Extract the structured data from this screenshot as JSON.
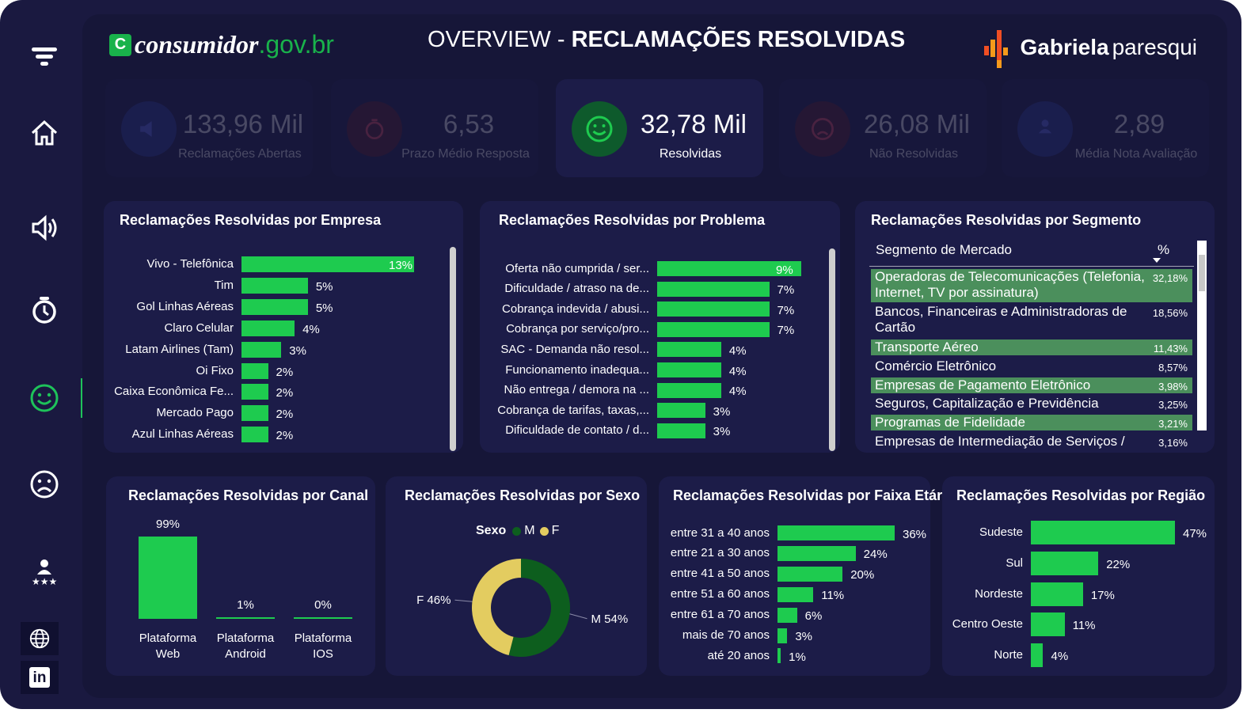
{
  "header": {
    "logo_left_badge": "C",
    "logo_left_1": "consumidor",
    "logo_left_2": ".gov.br",
    "title_light": "OVERVIEW - ",
    "title_bold": "RECLAMAÇÕES RESOLVIDAS",
    "logo_right_name": "Gabriela",
    "logo_right_surname": "paresqui"
  },
  "sidebar": {
    "items": [
      {
        "icon": "filter-icon"
      },
      {
        "icon": "home-icon"
      },
      {
        "icon": "speaker-icon"
      },
      {
        "icon": "timer-icon"
      },
      {
        "icon": "smile-icon",
        "active": true
      },
      {
        "icon": "sad-face-icon"
      },
      {
        "icon": "rating-person-icon"
      }
    ],
    "social": [
      {
        "icon": "globe-icon"
      },
      {
        "icon": "linkedin-icon",
        "label": "in"
      }
    ]
  },
  "kpis": [
    {
      "value": "133,96 Mil",
      "label": "Reclamações Abertas",
      "active": false
    },
    {
      "value": "6,53",
      "label": "Prazo Médio Resposta",
      "active": false
    },
    {
      "value": "32,78 Mil",
      "label": "Resolvidas",
      "active": true
    },
    {
      "value": "26,08 Mil",
      "label": "Não Resolvidas",
      "active": false
    },
    {
      "value": "2,89",
      "label": "Média Nota Avaliação",
      "active": false
    }
  ],
  "colors": {
    "accent": "#1ecb4f",
    "background": "#161638",
    "panel": "#1c1c48",
    "highlight_row": "#4b8f5c",
    "female": "#e3cc60",
    "male": "#0d5e1e"
  },
  "panels": {
    "empresa": {
      "title": "Reclamações Resolvidas por Empresa",
      "chart_data": {
        "type": "bar",
        "orientation": "horizontal",
        "categories": [
          "Vivo - Telefônica",
          "Tim",
          "Gol Linhas Aéreas",
          "Claro Celular",
          "Latam Airlines (Tam)",
          "Oi Fixo",
          "Caixa Econômica Fe...",
          "Mercado Pago",
          "Azul Linhas Aéreas"
        ],
        "values": [
          13,
          5,
          5,
          4,
          3,
          2,
          2,
          2,
          2
        ],
        "labels": [
          "13%",
          "5%",
          "5%",
          "4%",
          "3%",
          "2%",
          "2%",
          "2%",
          "2%"
        ],
        "max": 13
      }
    },
    "problema": {
      "title": "Reclamações Resolvidas por Problema",
      "chart_data": {
        "type": "bar",
        "orientation": "horizontal",
        "categories": [
          "Oferta não cumprida / ser...",
          "Dificuldade / atraso na de...",
          "Cobrança indevida / abusi...",
          "Cobrança por serviço/pro...",
          "SAC - Demanda não resol...",
          "Funcionamento inadequa...",
          "Não entrega / demora na ...",
          "Cobrança de tarifas, taxas,...",
          "Dificuldade de contato / d..."
        ],
        "values": [
          9,
          7,
          7,
          7,
          4,
          4,
          4,
          3,
          3
        ],
        "labels": [
          "9%",
          "7%",
          "7%",
          "7%",
          "4%",
          "4%",
          "4%",
          "3%",
          "3%"
        ],
        "max": 9
      }
    },
    "segmento": {
      "title": "Reclamações Resolvidas por Segmento",
      "col_name": "Segmento de Mercado",
      "col_pct": "%",
      "rows": [
        {
          "name": "Operadoras de Telecomunicações (Telefonia, Internet, TV por assinatura)",
          "pct": "32,18%",
          "highlight": true
        },
        {
          "name": "Bancos, Financeiras e Administradoras de Cartão",
          "pct": "18,56%",
          "highlight": false
        },
        {
          "name": "Transporte Aéreo",
          "pct": "11,43%",
          "highlight": true
        },
        {
          "name": "Comércio Eletrônico",
          "pct": "8,57%",
          "highlight": false
        },
        {
          "name": "Empresas de Pagamento Eletrônico",
          "pct": "3,98%",
          "highlight": true
        },
        {
          "name": "Seguros, Capitalização e Previdência",
          "pct": "3,25%",
          "highlight": false
        },
        {
          "name": "Programas de Fidelidade",
          "pct": "3,21%",
          "highlight": true
        },
        {
          "name": "Empresas de Intermediação de Serviços /",
          "pct": "3,16%",
          "highlight": false
        }
      ]
    },
    "canal": {
      "title": "Reclamações Resolvidas por Canal",
      "chart_data": {
        "type": "bar",
        "orientation": "vertical",
        "categories": [
          "Plataforma Web",
          "Plataforma Android",
          "Plataforma IOS"
        ],
        "category_lines": [
          [
            "Plataforma",
            "Web"
          ],
          [
            "Plataforma",
            "Android"
          ],
          [
            "Plataforma",
            "IOS"
          ]
        ],
        "values": [
          99,
          1,
          0
        ],
        "labels": [
          "99%",
          "1%",
          "0%"
        ],
        "max": 99
      }
    },
    "sexo": {
      "title": "Reclamações Resolvidas por Sexo",
      "legend_title": "Sexo",
      "chart_data": {
        "type": "pie",
        "donut": true,
        "categories": [
          "M",
          "F"
        ],
        "values": [
          54,
          46
        ],
        "labels": [
          "M 54%",
          "F 46%"
        ],
        "colors": [
          "#0d5e1e",
          "#e3cc60"
        ]
      }
    },
    "faixa": {
      "title": "Reclamações Resolvidas por Faixa Etária",
      "chart_data": {
        "type": "bar",
        "orientation": "horizontal",
        "categories": [
          "entre 31 a 40 anos",
          "entre 21 a 30 anos",
          "entre 41 a 50 anos",
          "entre 51 a 60 anos",
          "entre 61 a 70 anos",
          "mais de 70 anos",
          "até 20 anos"
        ],
        "values": [
          36,
          24,
          20,
          11,
          6,
          3,
          1
        ],
        "labels": [
          "36%",
          "24%",
          "20%",
          "11%",
          "6%",
          "3%",
          "1%"
        ],
        "max": 36
      }
    },
    "regiao": {
      "title": "Reclamações Resolvidas por Região",
      "chart_data": {
        "type": "bar",
        "orientation": "horizontal",
        "categories": [
          "Sudeste",
          "Sul",
          "Nordeste",
          "Centro Oeste",
          "Norte"
        ],
        "values": [
          47,
          22,
          17,
          11,
          4
        ],
        "labels": [
          "47%",
          "22%",
          "17%",
          "11%",
          "4%"
        ],
        "max": 47
      }
    }
  }
}
